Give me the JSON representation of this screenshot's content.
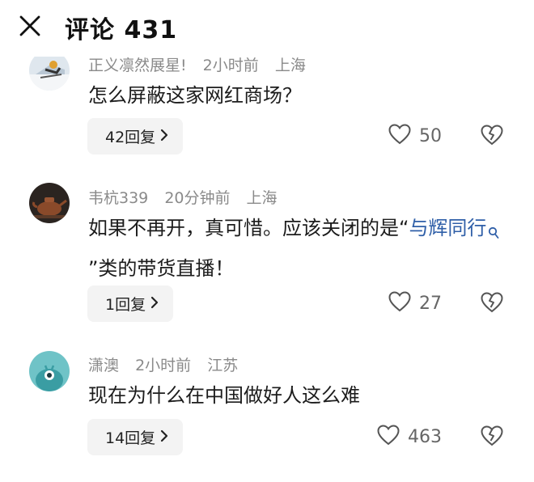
{
  "header": {
    "title": "评论 431"
  },
  "comments": [
    {
      "meta": {
        "user": "正义凛然展星!",
        "time": "2小时前",
        "location": "上海"
      },
      "text": "怎么屏蔽这家网红商场？",
      "reply_label": "42回复",
      "likes": "50"
    },
    {
      "meta": {
        "user": "韦杭339",
        "time": "20分钟前",
        "location": "上海"
      },
      "text_before": "如果不再开，真可惜。应该关闭的是“",
      "link_text": "与辉同行",
      "text_after": "”类的带货直播！",
      "reply_label": "1回复",
      "likes": "27"
    },
    {
      "meta": {
        "user": "潇澳",
        "time": "2小时前",
        "location": "江苏"
      },
      "text": "现在为什么在中国做好人这么难",
      "reply_label": "14回复",
      "likes": "463"
    }
  ],
  "colors": {
    "link": "#2f5fa8",
    "meta": "#8a8a8a",
    "reply_bg": "#f3f3f3"
  }
}
